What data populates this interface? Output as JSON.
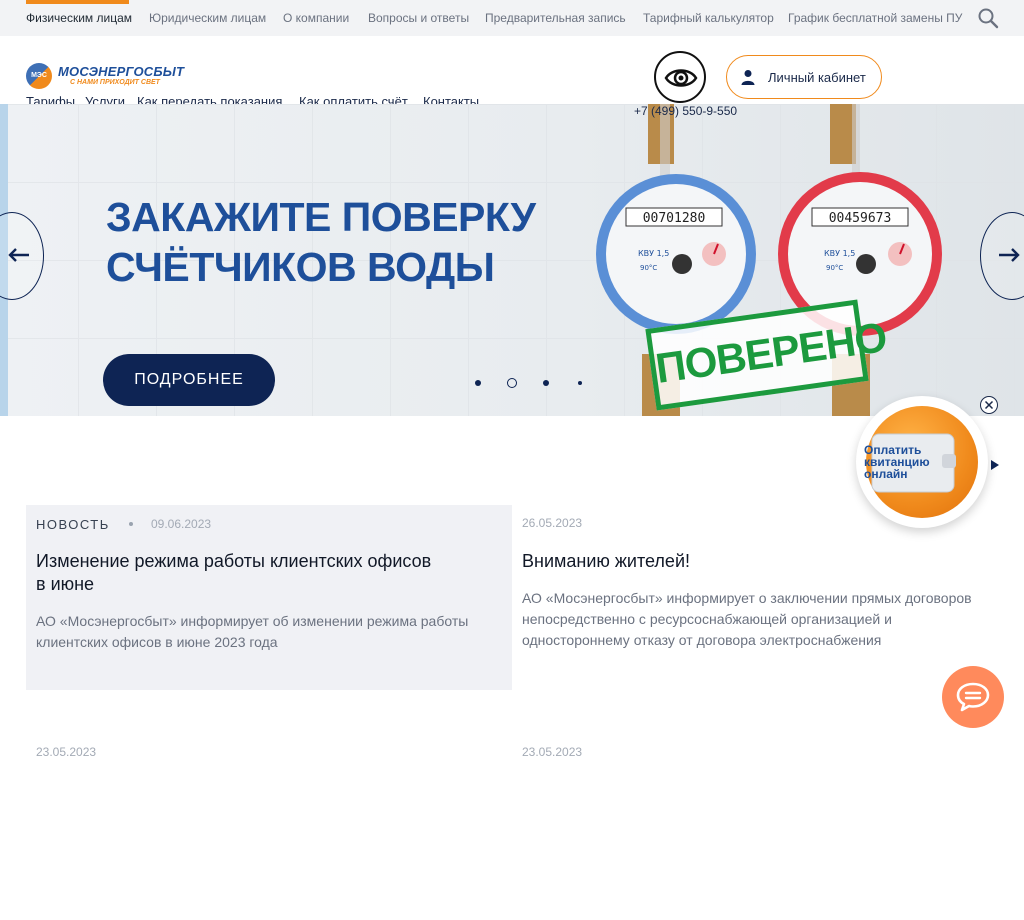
{
  "topnav": {
    "items": [
      "Физическим лицам",
      "Юридическим лицам",
      "О компании",
      "Вопросы и ответы",
      "Предварительная запись",
      "Тарифный калькулятор",
      "График бесплатной замены ПУ"
    ],
    "active_index": 0,
    "accent_color": "#f08a1c"
  },
  "logo": {
    "badge": "МЭС",
    "name": "МОСЭНЕРГОСБЫТ",
    "slogan": "С НАМИ ПРИХОДИТ СВЕТ"
  },
  "mainnav": {
    "items": [
      "Тарифы",
      "Услуги",
      "Как передать показания",
      "Как оплатить счёт",
      "Контакты"
    ]
  },
  "header": {
    "accessibility_icon": "eye-icon",
    "cabinet_label": "Личный кабинет",
    "phone": "+7 (499) 550-9-550"
  },
  "hero": {
    "title_line1": "ЗАКАЖИТЕ ПОВЕРКУ",
    "title_line2": "СЧЁТЧИКОВ ВОДЫ",
    "button_label": "ПОДРОБНЕЕ",
    "stamp_text": "ПОВЕРЕНО",
    "meter_left_reading": "00701280",
    "meter_right_reading": "00459673",
    "slides_count": 4,
    "active_slide": 1
  },
  "pay_widget": {
    "label": "Оплатить\nквитанцию\nонлайн"
  },
  "news": [
    {
      "type": "НОВОСТЬ",
      "date": "09.06.2023",
      "title": "Изменение режима работы клиентских офисов в июне",
      "desc": "АО «Мосэнергосбыт» информирует об изменении режима работы клиентских офисов в июне 2023 года"
    },
    {
      "type": "",
      "date": "26.05.2023",
      "title": "Вниманию жителей!",
      "desc": "АО «Мосэнергосбыт» информирует о заключении прямых договоров непосредственно с ресурсоснабжающей организацией и одностороннему отказу от договора электроснабжения"
    },
    {
      "date": "23.05.2023"
    },
    {
      "date": "23.05.2023"
    }
  ],
  "colors": {
    "brand_blue": "#1e4f9a",
    "dark_navy": "#0e2454",
    "orange": "#f08a1c",
    "green_stamp": "#1c9a3e",
    "chat_orange": "#ff8a5c"
  }
}
